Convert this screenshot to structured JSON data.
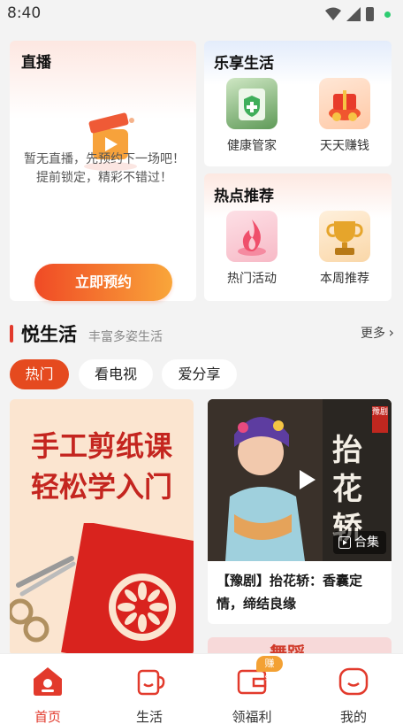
{
  "status_bar": {
    "time": "8:40"
  },
  "live": {
    "title": "直播",
    "message": "暂无直播，先预约下一场吧！提前锁定，精彩不错过！",
    "button_label": "立即预约"
  },
  "lifestyle": {
    "title": "乐享生活",
    "items": [
      {
        "label": "健康管家",
        "icon": "health-shield-icon"
      },
      {
        "label": "天天赚钱",
        "icon": "money-gift-icon"
      }
    ]
  },
  "hot": {
    "title": "热点推荐",
    "items": [
      {
        "label": "热门活动",
        "icon": "flame-icon"
      },
      {
        "label": "本周推荐",
        "icon": "trophy-icon"
      }
    ]
  },
  "section": {
    "title": "悦生活",
    "subtitle": "丰富多姿生活",
    "more_label": "更多"
  },
  "chips": [
    {
      "label": "热门",
      "active": true
    },
    {
      "label": "看电视",
      "active": false
    },
    {
      "label": "爱分享",
      "active": false
    }
  ],
  "feed": {
    "left_headline_1": "手工剪纸课",
    "left_headline_2": "轻松学入门",
    "right_thumb_text_top": "豫剧",
    "right_thumb_text": "抬花轿",
    "right_collection_label": "合集",
    "right_caption": "【豫剧】抬花轿：香囊定情，缔结良缘",
    "right2_text": "舞蹈"
  },
  "bottom_nav": [
    {
      "label": "首页",
      "active": true,
      "icon": "home-icon"
    },
    {
      "label": "生活",
      "active": false,
      "icon": "cup-icon"
    },
    {
      "label": "领福利",
      "active": false,
      "icon": "wallet-icon",
      "badge": "赚钱"
    },
    {
      "label": "我的",
      "active": false,
      "icon": "profile-icon"
    }
  ],
  "colors": {
    "accent": "#e23a2c",
    "button_start": "#f04a25",
    "button_end": "#f9a63a"
  }
}
